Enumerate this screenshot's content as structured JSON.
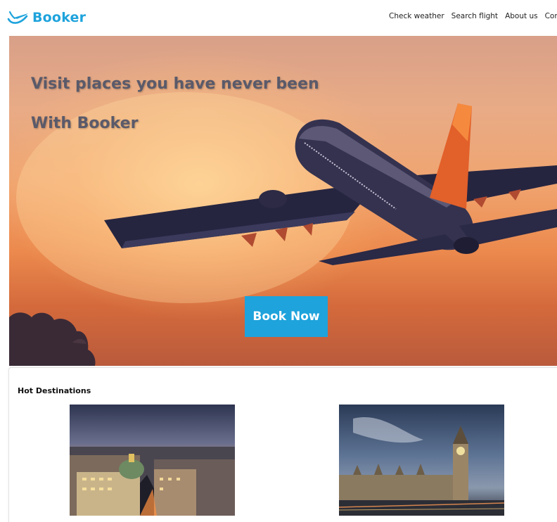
{
  "header": {
    "logo_text": "Booker",
    "logo_icon": "plane-swoosh-icon",
    "nav": [
      {
        "label": "Check weather"
      },
      {
        "label": "Search flight"
      },
      {
        "label": "About us"
      },
      {
        "label": "Contact us"
      }
    ]
  },
  "hero": {
    "title_line1": "Visit places you have never been",
    "title_line2": "With Booker",
    "cta_label": "Book Now"
  },
  "destinations": {
    "title": "Hot Destinations"
  },
  "colors": {
    "accent": "#1ea3dc",
    "hero_title": "#5a5a6a"
  }
}
